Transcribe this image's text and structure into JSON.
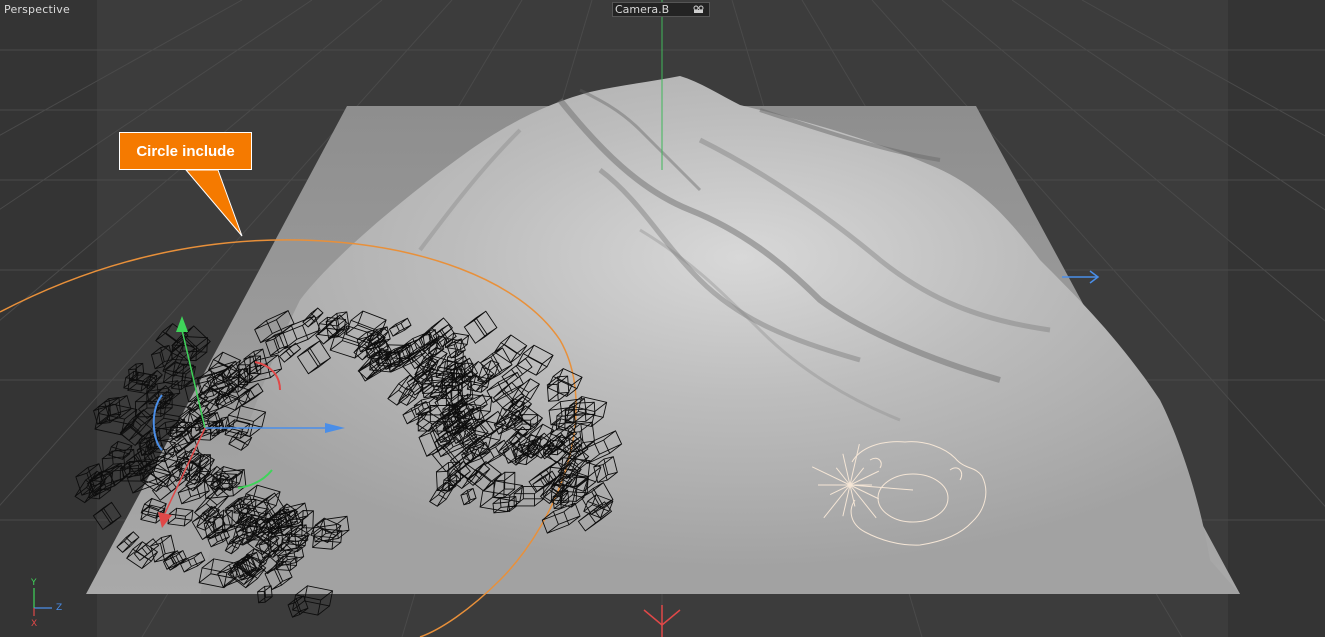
{
  "viewport": {
    "view_label": "Perspective",
    "camera_label": "Camera.B",
    "camera_icon": "camera-icon"
  },
  "annotation": {
    "callout_text": "Circle include",
    "callout_color": "#f57a00"
  },
  "axis_indicator": {
    "y": "Y",
    "z": "Z",
    "x": "X"
  },
  "colors": {
    "viewport_bg": "#3c3c3c",
    "plane": "#9e9e9e",
    "spline": "#e8903a",
    "axis_x": "#e04848",
    "axis_y": "#3fd45a",
    "axis_z": "#4a8ee8",
    "emitter": "#f5e6d6"
  }
}
